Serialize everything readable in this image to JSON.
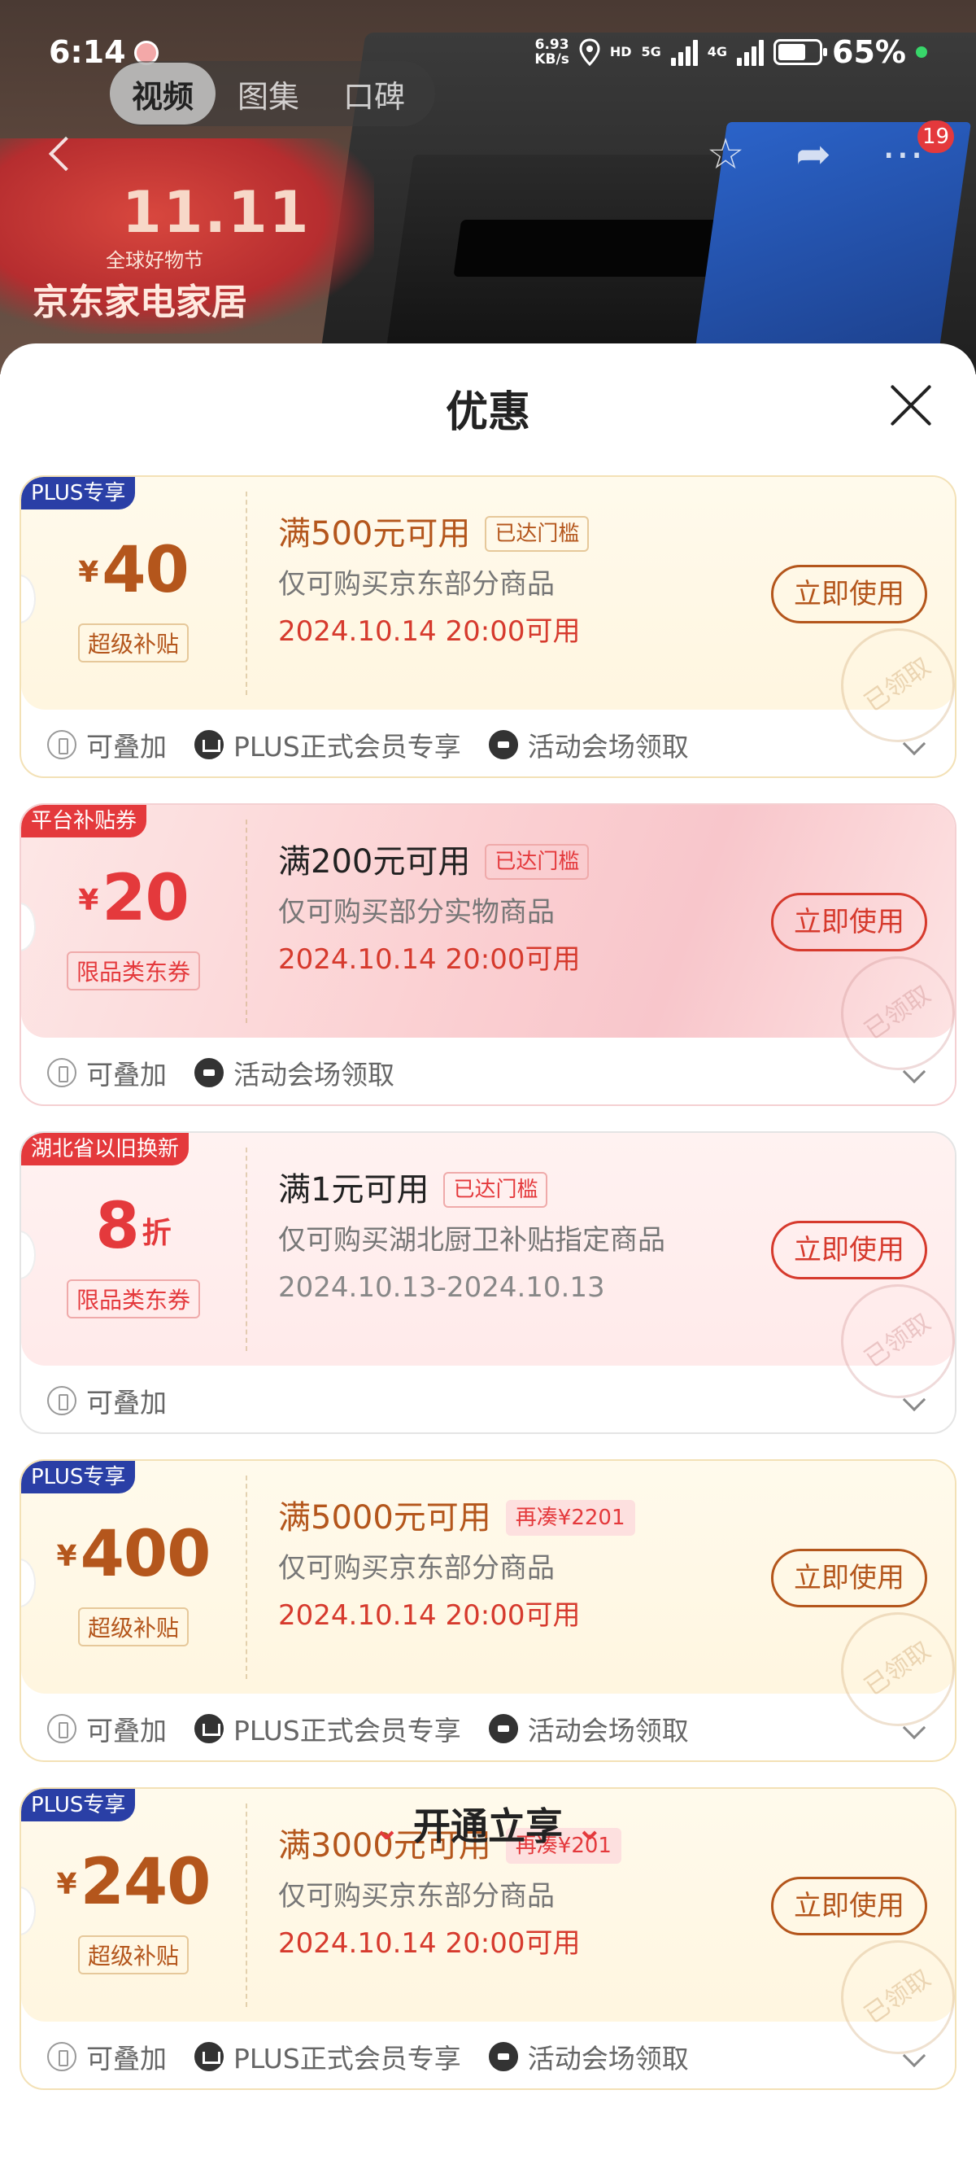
{
  "status_bar": {
    "time": "6:14",
    "net_speed_value": "6.93",
    "net_speed_unit": "KB/s",
    "hd_label": "HD",
    "sim1": "5G",
    "sim2": "4G",
    "battery": "65%"
  },
  "media_tabs": [
    {
      "label": "视频",
      "active": true
    },
    {
      "label": "图集",
      "active": false
    },
    {
      "label": "口碑",
      "active": false
    }
  ],
  "nav": {
    "badge_count": "19"
  },
  "banner": {
    "big": "11.11",
    "sub": "全球好物节",
    "name": "京东家电家居"
  },
  "sheet": {
    "title": "优惠"
  },
  "coupons": [
    {
      "tag": "PLUS专享",
      "currency": "¥",
      "amount": "40",
      "label": "超级补贴",
      "condition": "满500元可用",
      "threshold": "已达门槛",
      "desc": "仅可购买京东部分商品",
      "date": "2024.10.14 20:00可用",
      "button": "立即使用",
      "stamp": "已领取",
      "features": [
        "可叠加",
        "PLUS正式会员专享",
        "活动会场领取"
      ]
    },
    {
      "tag": "平台补贴券",
      "currency": "¥",
      "amount": "20",
      "label": "限品类东券",
      "condition": "满200元可用",
      "threshold": "已达门槛",
      "desc": "仅可购买部分实物商品",
      "date": "2024.10.14 20:00可用",
      "button": "立即使用",
      "stamp": "已领取",
      "features": [
        "可叠加",
        "活动会场领取"
      ]
    },
    {
      "tag": "湖北省以旧换新",
      "amount": "8",
      "unit": "折",
      "label": "限品类东券",
      "condition": "满1元可用",
      "threshold": "已达门槛",
      "desc": "仅可购买湖北厨卫补贴指定商品",
      "date": "2024.10.13-2024.10.13",
      "button": "立即使用",
      "stamp": "已领取",
      "features": [
        "可叠加"
      ]
    },
    {
      "tag": "PLUS专享",
      "currency": "¥",
      "amount": "400",
      "label": "超级补贴",
      "condition": "满5000元可用",
      "threshold": "再凑¥2201",
      "desc": "仅可购买京东部分商品",
      "date": "2024.10.14 20:00可用",
      "button": "立即使用",
      "stamp": "已领取",
      "features": [
        "可叠加",
        "PLUS正式会员专享",
        "活动会场领取"
      ]
    },
    {
      "tag": "PLUS专享",
      "currency": "¥",
      "amount": "240",
      "label": "超级补贴",
      "condition": "满3000元可用",
      "threshold": "再凑¥201",
      "desc": "仅可购买京东部分商品",
      "date": "2024.10.14 20:00可用",
      "button": "立即使用",
      "stamp": "已领取",
      "features": [
        "可叠加",
        "PLUS正式会员专享",
        "活动会场领取"
      ]
    }
  ],
  "footer": {
    "open_plus": "开通立享"
  }
}
